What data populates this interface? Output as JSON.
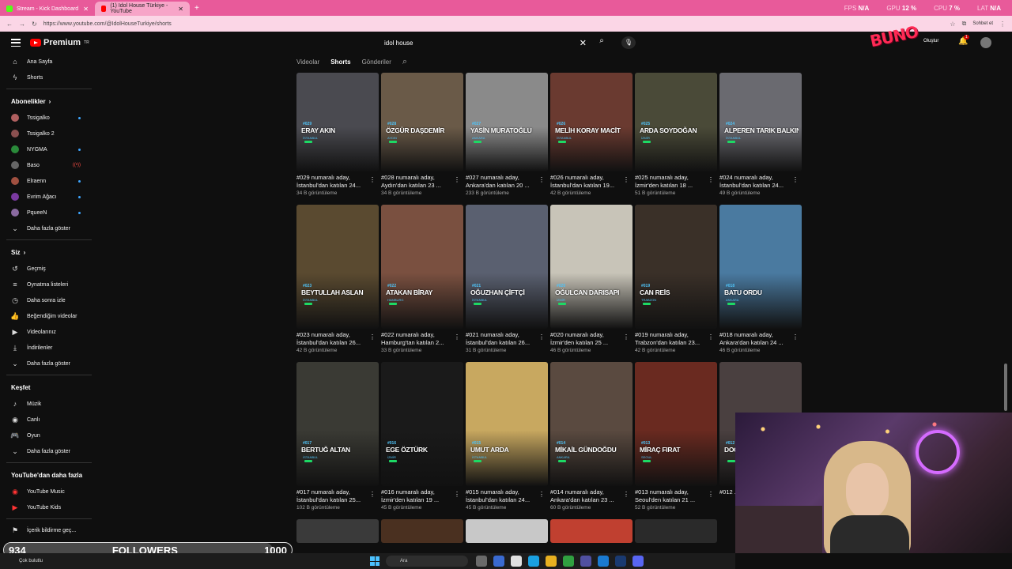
{
  "browser": {
    "tabs": [
      {
        "label": "Stream - Kick Dashboard",
        "color": "#53fc18"
      },
      {
        "label": "(1) Idol House Türkiye - YouTube",
        "color": "#ff0000"
      }
    ],
    "url": "https://www.youtube.com/@IdolHouseTurkiye/shorts",
    "perf": {
      "fps_label": "FPS",
      "fps": "N/A",
      "gpu_label": "GPU",
      "gpu": "12 %",
      "cpu_label": "CPU",
      "cpu": "7 %",
      "lat_label": "LAT",
      "lat": "N/A"
    },
    "chat_button": "Sohbet et"
  },
  "youtube": {
    "logo": "Premium",
    "logo_sup": "TR",
    "search_value": "idol house",
    "create_label": "Oluştur",
    "notifications": "1",
    "overlay_logo": "BUNO"
  },
  "sidebar": {
    "main": [
      {
        "label": "Ana Sayfa",
        "icon": "home-icon",
        "glyph": "⌂"
      },
      {
        "label": "Shorts",
        "icon": "shorts-icon",
        "glyph": "ϟ"
      }
    ],
    "subs_title": "Abonelikler",
    "subs": [
      {
        "label": "Tssigalko",
        "color": "#b06060",
        "status": "dot"
      },
      {
        "label": "Tssigalko 2",
        "color": "#8a5050",
        "status": ""
      },
      {
        "label": "NYGMA",
        "color": "#2a8a3a",
        "status": "dot"
      },
      {
        "label": "Baso",
        "color": "#666",
        "status": "live"
      },
      {
        "label": "Elraenn",
        "color": "#a05040",
        "status": "dot"
      },
      {
        "label": "Evrim Ağacı",
        "color": "#7a3aa0",
        "status": "dot"
      },
      {
        "label": "PqueeN",
        "color": "#8a6aa0",
        "status": "dot"
      }
    ],
    "more_label": "Daha fazla göster",
    "you_title": "Siz",
    "you": [
      {
        "label": "Geçmiş",
        "icon": "history-icon",
        "glyph": "↺"
      },
      {
        "label": "Oynatma listeleri",
        "icon": "playlist-icon",
        "glyph": "≡"
      },
      {
        "label": "Daha sonra izle",
        "icon": "watch-later-icon",
        "glyph": "◷"
      },
      {
        "label": "Beğendiğim videolar",
        "icon": "like-icon",
        "glyph": "👍"
      },
      {
        "label": "Videolarınız",
        "icon": "your-videos-icon",
        "glyph": "▶"
      },
      {
        "label": "İndirilenler",
        "icon": "download-icon",
        "glyph": "⤓"
      },
      {
        "label": "Daha fazla göster",
        "icon": "chevron-down-icon",
        "glyph": "⌄"
      }
    ],
    "explore_title": "Keşfet",
    "explore": [
      {
        "label": "Müzik",
        "icon": "music-icon",
        "glyph": "♪"
      },
      {
        "label": "Canlı",
        "icon": "live-icon",
        "glyph": "◉"
      },
      {
        "label": "Oyun",
        "icon": "gaming-icon",
        "glyph": "🎮"
      },
      {
        "label": "Daha fazla göster",
        "icon": "chevron-down-icon",
        "glyph": "⌄"
      }
    ],
    "more_yt_title": "YouTube'dan daha fazla",
    "more_yt": [
      {
        "label": "YouTube Music",
        "icon": "youtube-music-icon",
        "glyph": "◉"
      },
      {
        "label": "YouTube Kids",
        "icon": "youtube-kids-icon",
        "glyph": "▶"
      }
    ],
    "report_label": "İçerik bildirme geç..."
  },
  "chips": [
    "Videolar",
    "Shorts",
    "Gönderiler"
  ],
  "rows": [
    [
      {
        "num": "#029",
        "name": "ERAY AKIN",
        "city": "İSTANBUL",
        "title": "#029 numaralı aday, İstanbul'dan katılan 24...",
        "views": "34 B görüntüleme",
        "bg": "#4a4a50"
      },
      {
        "num": "#028",
        "name": "ÖZGÜR DAŞDEMİR",
        "city": "AYDIN",
        "title": "#028 numaralı aday, Aydın'dan katılan 23 ...",
        "views": "34 B görüntüleme",
        "bg": "#6a5a48"
      },
      {
        "num": "#027",
        "name": "YASİN MURATOĞLU",
        "city": "ANKARA",
        "title": "#027 numaralı aday, Ankara'dan katılan 20 ...",
        "views": "233 B görüntüleme",
        "bg": "#8a8a8a"
      },
      {
        "num": "#026",
        "name": "MELİH KORAY MACİT",
        "city": "İSTANBUL",
        "title": "#026 numaralı aday, İstanbul'dan katılan 19...",
        "views": "42 B görüntüleme",
        "bg": "#6a3a30"
      },
      {
        "num": "#025",
        "name": "ARDA SOYDOĞAN",
        "city": "İZMİR",
        "title": "#025 numaralı aday, İzmir'den katılan 18 ...",
        "views": "51 B görüntüleme",
        "bg": "#4a4a38"
      },
      {
        "num": "#024",
        "name": "ALPEREN TARIK BALKIN",
        "city": "İSTANBUL",
        "title": "#024 numaralı aday, İstanbul'dan katılan 24...",
        "views": "49 B görüntüleme",
        "bg": "#6a6a70"
      }
    ],
    [
      {
        "num": "#023",
        "name": "BEYTULLAH ASLAN",
        "city": "İSTANBUL",
        "title": "#023 numaralı aday, İstanbul'dan katılan 26...",
        "views": "42 B görüntüleme",
        "bg": "#5a4a30"
      },
      {
        "num": "#022",
        "name": "ATAKAN BİRAY",
        "city": "HAMBURG",
        "title": "#022 numaralı aday, Hamburg'tan katılan 2...",
        "views": "33 B görüntüleme",
        "bg": "#7a5040"
      },
      {
        "num": "#021",
        "name": "OĞUZHAN ÇİFTÇİ",
        "city": "İSTANBUL",
        "title": "#021 numaralı aday, İstanbul'dan katılan 26...",
        "views": "31 B görüntüleme",
        "bg": "#5a6070"
      },
      {
        "num": "#020",
        "name": "OĞULCAN DARISAPI",
        "city": "İZMİR",
        "title": "#020 numaralı aday, İzmir'den katılan 25 ...",
        "views": "46 B görüntüleme",
        "bg": "#c8c4b8"
      },
      {
        "num": "#019",
        "name": "CAN REİS",
        "city": "TRABZON",
        "title": "#019 numaralı aday, Trabzon'dan katılan 23...",
        "views": "42 B görüntüleme",
        "bg": "#3a3028"
      },
      {
        "num": "#018",
        "name": "BATU ORDU",
        "city": "ANKARA",
        "title": "#018 numaralı aday, Ankara'dan katılan 24 ...",
        "views": "46 B görüntüleme",
        "bg": "#4a7aa0"
      }
    ],
    [
      {
        "num": "#017",
        "name": "BERTUĞ ALTAN",
        "city": "İSTANBUL",
        "title": "#017 numaralı aday, İstanbul'dan katılan 25...",
        "views": "102 B görüntüleme",
        "bg": "#3a3a34"
      },
      {
        "num": "#016",
        "name": "EGE ÖZTÜRK",
        "city": "İZMİR",
        "title": "#016 numaralı aday, İzmir'den katılan 19 ...",
        "views": "45 B görüntüleme",
        "bg": "#1a1a1a"
      },
      {
        "num": "#015",
        "name": "UMUT ARDA",
        "city": "İSTANBUL",
        "title": "#015 numaralı aday, İstanbul'dan katılan 24...",
        "views": "45 B görüntüleme",
        "bg": "#c8a860"
      },
      {
        "num": "#014",
        "name": "MİKAİL GÜNDOĞDU",
        "city": "ANKARA",
        "title": "#014 numaralı aday, Ankara'dan katılan 23 ...",
        "views": "60 B görüntüleme",
        "bg": "#5a4a40"
      },
      {
        "num": "#013",
        "name": "MİRAÇ FIRAT",
        "city": "SEOUL",
        "title": "#013 numaralı aday, Seoul'den katılan 21 ...",
        "views": "52 B görüntüleme",
        "bg": "#6a2a20"
      },
      {
        "num": "#012",
        "name": "DOĞ",
        "city": "",
        "title": "#012 ... İstanb...",
        "views": "",
        "bg": "#4a4040"
      }
    ]
  ],
  "followers": {
    "current": "934",
    "label": "FOLLOWERS",
    "goal": "1000",
    "progress": 0.934
  },
  "taskbar": {
    "status": "Çok bulutlu",
    "search": "Ara"
  }
}
